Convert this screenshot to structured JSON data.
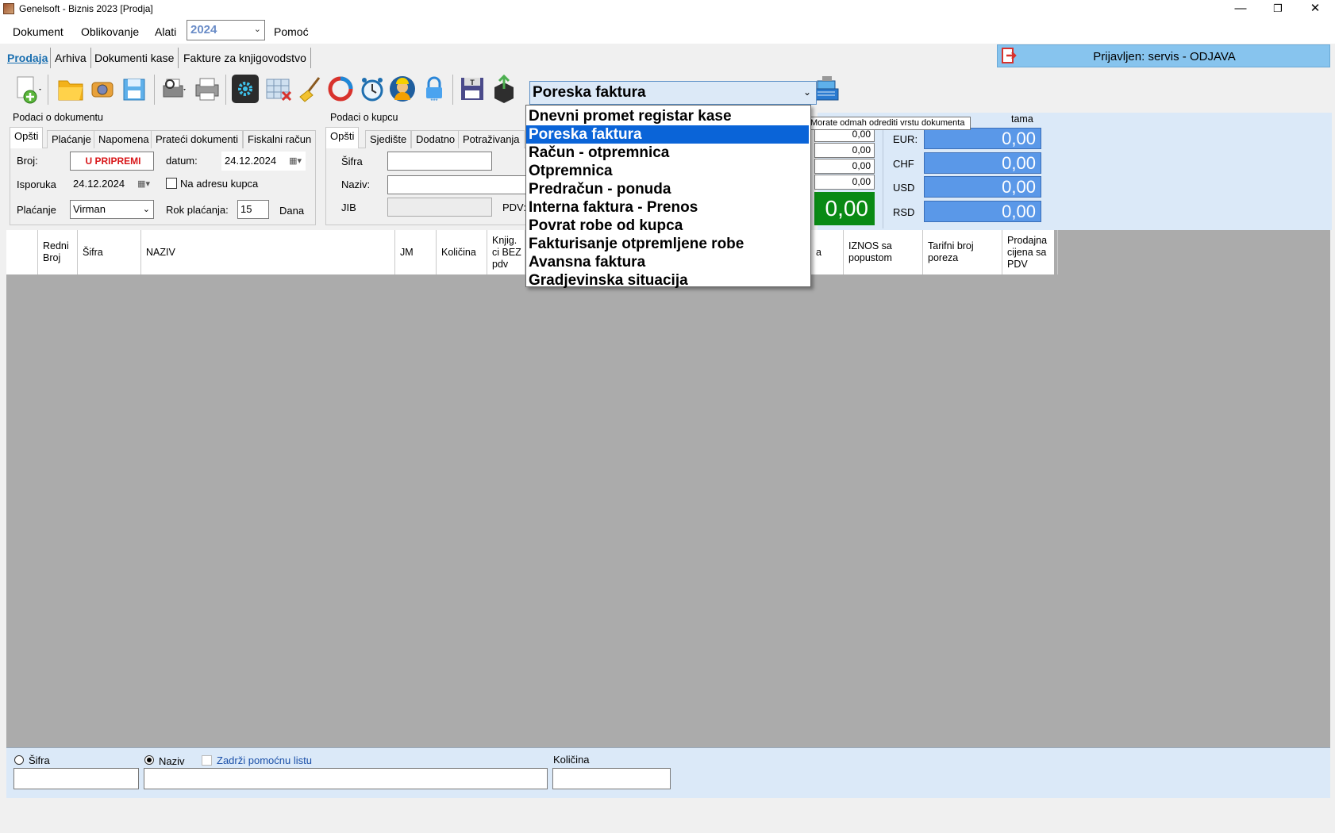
{
  "window": {
    "title": "Genelsoft - Biznis 2023 [Prodja]",
    "minimize": "—",
    "restore": "❐",
    "close": "✕"
  },
  "menu": {
    "items": [
      "Dokument",
      "Oblikovanje",
      "Alati"
    ],
    "year": "2024",
    "help": "Pomoć"
  },
  "tabs": [
    "Prodaja",
    "Arhiva",
    "Dokumenti kase",
    "Fakture za knjigovodstvo"
  ],
  "logout": {
    "label": "Prijavljen: servis - ODJAVA"
  },
  "toolbar": {
    "icons": [
      "new-document-icon",
      "open-folder-icon",
      "camera-icon",
      "save-icon",
      "print-preview-icon",
      "printer-icon",
      "settings-icon",
      "delete-grid-icon",
      "broom-icon",
      "refresh-icon",
      "alarm-clock-icon",
      "worker-icon",
      "lock-icon",
      "text-save-icon",
      "export-box-icon",
      "cash-register-icon"
    ]
  },
  "doc_type": {
    "selected": "Poreska faktura",
    "options": [
      "Dnevni promet registar kase",
      "Poreska faktura",
      "Račun - otpremnica",
      "Otpremnica",
      "Predračun - ponuda",
      "Interna faktura - Prenos",
      "Povrat robe od kupca",
      "Fakturisanje otpremljene robe",
      "Avansna faktura",
      "Gradjevinska situacija"
    ],
    "tooltip": "Morate odmah odrediti vrstu dokumenta"
  },
  "document": {
    "group_title": "Podaci o dokumentu",
    "tabs": [
      "Opšti",
      "Plaćanje",
      "Napomena",
      "Prateći dokumenti",
      "Fiskalni račun"
    ],
    "broj_label": "Broj:",
    "broj_value": "U PRIPREMI",
    "datum_label": "datum:",
    "datum_value": "24.12.2024",
    "isporuka_label": "Isporuka",
    "isporuka_value": "24.12.2024",
    "na_adresu_label": "Na adresu kupca",
    "placanje_label": "Plaćanje",
    "placanje_value": "Virman",
    "rok_label": "Rok plaćanja:",
    "rok_value": "15",
    "dana_label": "Dana"
  },
  "customer": {
    "group_title": "Podaci o kupcu",
    "tabs": [
      "Opšti",
      "Sjedište",
      "Dodatno",
      "Potraživanja"
    ],
    "sifra_label": "Šifra",
    "naziv_label": "Naziv:",
    "jib_label": "JIB",
    "pdv_label": "PDV:"
  },
  "totals": {
    "header_partial": "tama",
    "small_values": [
      "0,00",
      "0,00",
      "0,00",
      "0,00"
    ],
    "grand_total": "0,00",
    "currencies": [
      {
        "code": "EUR:",
        "value": "0,00"
      },
      {
        "code": "CHF",
        "value": "0,00"
      },
      {
        "code": "USD",
        "value": "0,00"
      },
      {
        "code": "RSD",
        "value": "0,00"
      }
    ]
  },
  "grid": {
    "columns": [
      "Redni Broj",
      "Šifra",
      "NAZIV",
      "JM",
      "Količina",
      "Knjig. ci BEZ pdv",
      "a",
      "IZNOS sa popustom",
      "Tarifni broj poreza",
      "Prodajna cijena sa PDV"
    ]
  },
  "bottom": {
    "sifra_radio": "Šifra",
    "naziv_radio": "Naziv",
    "zadrzi_label": "Zadrži pomoćnu listu",
    "kolicina_label": "Količina"
  }
}
